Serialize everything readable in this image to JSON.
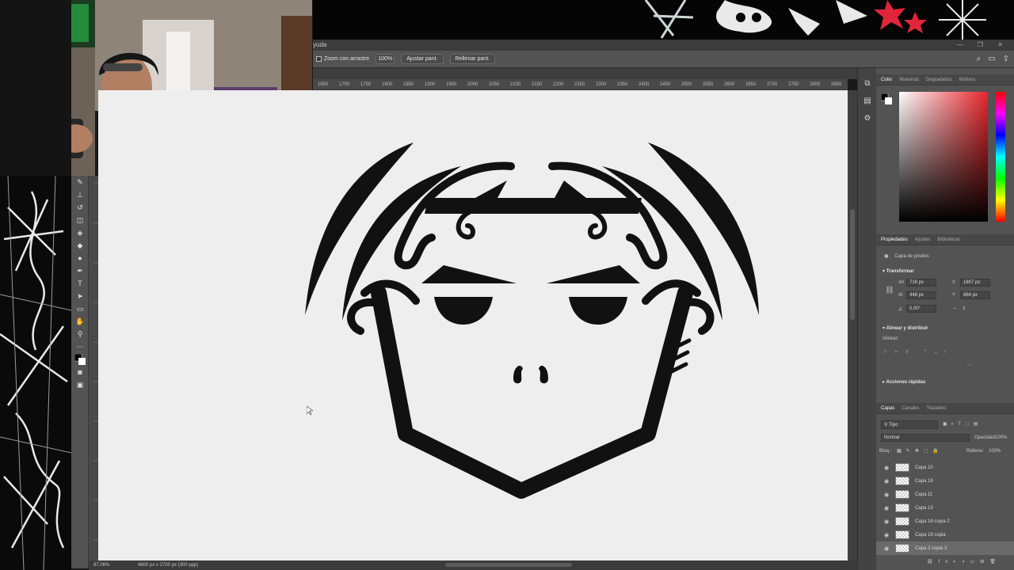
{
  "window": {
    "title": "yuda",
    "controls": "— ❐ ✕"
  },
  "options_bar": {
    "zoom_drag_label": "Zoom con arrastre",
    "zoom_value": "100%",
    "fit_screen": "Ajustar pant.",
    "fill_screen": "Rellenar pant."
  },
  "ruler_ticks": [
    "1650",
    "1700",
    "1750",
    "1800",
    "1850",
    "1900",
    "1950",
    "2000",
    "2050",
    "2100",
    "2150",
    "2200",
    "2250",
    "2300",
    "2350",
    "2400",
    "2450",
    "2500",
    "2550",
    "2600",
    "2650",
    "2700",
    "2750",
    "2800",
    "2850"
  ],
  "left_ruler_ticks": [
    "6",
    "5",
    "0",
    "7",
    "5",
    "0",
    "8",
    "0",
    "0",
    "8",
    "5",
    "0",
    "9",
    "0",
    "0",
    "9",
    "5",
    "0",
    "1",
    "0",
    "0",
    "0",
    "1",
    "0",
    "5",
    "0"
  ],
  "status": {
    "zoom": "87,06%",
    "dimensions": "4800 px x 2700 px (300 ppp)"
  },
  "color_panel": {
    "tabs": [
      "Color",
      "Muestras",
      "Degradados",
      "Motivos"
    ],
    "active_tab": "Color",
    "hue_color": "#e8262b"
  },
  "properties_panel": {
    "tabs": [
      "Propiedades",
      "Ajustes",
      "Bibliotecas"
    ],
    "layer_type": "Capa de píxeles",
    "transform_header": "Transformar",
    "width_label": "An",
    "width_value": "716 px",
    "x_label": "X",
    "x_value": "1807 px",
    "height_label": "Al",
    "height_value": "448 px",
    "y_label": "Y",
    "y_value": "664 px",
    "angle_value": "0,00°",
    "align_header": "Alinear y distribuir",
    "align_label": "Alinear:",
    "quick_actions": "Acciones rápidas"
  },
  "layers_panel": {
    "tabs": [
      "Capas",
      "Canales",
      "Trazados"
    ],
    "filter_label": "Tipo",
    "blend_mode": "Normal",
    "opacity_label": "Opacidad:",
    "opacity_value": "100%",
    "lock_label": "Bloq.:",
    "fill_label": "Relleno:",
    "fill_value": "100%",
    "layers": [
      {
        "name": "Capa 10",
        "selected": false
      },
      {
        "name": "Capa 18",
        "selected": false
      },
      {
        "name": "Capa 11",
        "selected": false
      },
      {
        "name": "Capa 13",
        "selected": false
      },
      {
        "name": "Capa 18 copia 2",
        "selected": false
      },
      {
        "name": "Capa 18 copia",
        "selected": false
      },
      {
        "name": "Capa 3 copia 3",
        "selected": true
      }
    ]
  }
}
